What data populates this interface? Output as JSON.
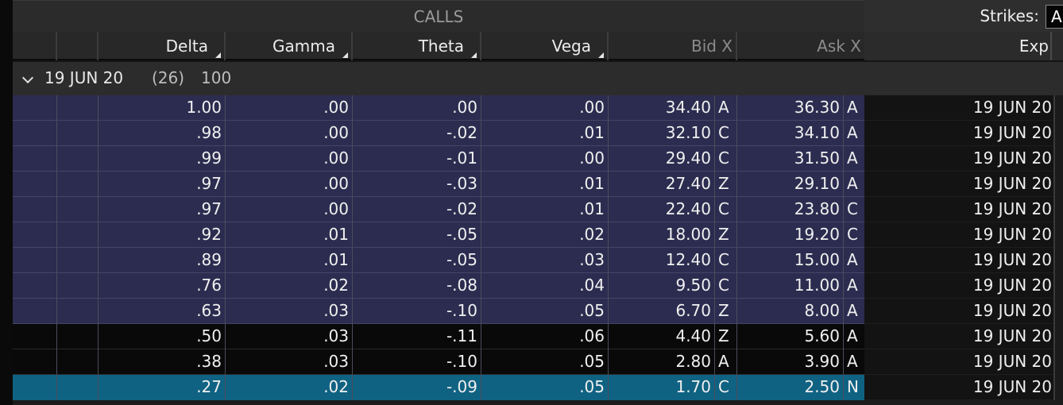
{
  "header": {
    "section_title": "CALLS",
    "strikes_label": "Strikes:",
    "strikes_value": "A",
    "columns": [
      "Delta",
      "Gamma",
      "Theta",
      "Vega",
      "Bid X",
      "Ask X"
    ],
    "exp_label": "Exp"
  },
  "group": {
    "date": "19 JUN 20",
    "count": "(26)",
    "multiplier": "100"
  },
  "rows": [
    {
      "delta": "1.00",
      "gamma": ".00",
      "theta": ".00",
      "vega": ".00",
      "bid": "34.40",
      "bid_ex": "A",
      "ask": "36.30",
      "ask_ex": "A",
      "exp": "19 JUN 20",
      "style": "itm"
    },
    {
      "delta": ".98",
      "gamma": ".00",
      "theta": "-.02",
      "vega": ".01",
      "bid": "32.10",
      "bid_ex": "C",
      "ask": "34.10",
      "ask_ex": "A",
      "exp": "19 JUN 20",
      "style": "itm"
    },
    {
      "delta": ".99",
      "gamma": ".00",
      "theta": "-.01",
      "vega": ".00",
      "bid": "29.40",
      "bid_ex": "C",
      "ask": "31.50",
      "ask_ex": "A",
      "exp": "19 JUN 20",
      "style": "itm"
    },
    {
      "delta": ".97",
      "gamma": ".00",
      "theta": "-.03",
      "vega": ".01",
      "bid": "27.40",
      "bid_ex": "Z",
      "ask": "29.10",
      "ask_ex": "A",
      "exp": "19 JUN 20",
      "style": "itm"
    },
    {
      "delta": ".97",
      "gamma": ".00",
      "theta": "-.02",
      "vega": ".01",
      "bid": "22.40",
      "bid_ex": "C",
      "ask": "23.80",
      "ask_ex": "C",
      "exp": "19 JUN 20",
      "style": "itm"
    },
    {
      "delta": ".92",
      "gamma": ".01",
      "theta": "-.05",
      "vega": ".02",
      "bid": "18.00",
      "bid_ex": "Z",
      "ask": "19.20",
      "ask_ex": "C",
      "exp": "19 JUN 20",
      "style": "itm"
    },
    {
      "delta": ".89",
      "gamma": ".01",
      "theta": "-.05",
      "vega": ".03",
      "bid": "12.40",
      "bid_ex": "C",
      "ask": "15.00",
      "ask_ex": "A",
      "exp": "19 JUN 20",
      "style": "itm"
    },
    {
      "delta": ".76",
      "gamma": ".02",
      "theta": "-.08",
      "vega": ".04",
      "bid": "9.50",
      "bid_ex": "C",
      "ask": "11.00",
      "ask_ex": "A",
      "exp": "19 JUN 20",
      "style": "itm"
    },
    {
      "delta": ".63",
      "gamma": ".03",
      "theta": "-.10",
      "vega": ".05",
      "bid": "6.70",
      "bid_ex": "Z",
      "ask": "8.00",
      "ask_ex": "A",
      "exp": "19 JUN 20",
      "style": "itm"
    },
    {
      "delta": ".50",
      "gamma": ".03",
      "theta": "-.11",
      "vega": ".06",
      "bid": "4.40",
      "bid_ex": "Z",
      "ask": "5.60",
      "ask_ex": "A",
      "exp": "19 JUN 20",
      "style": "otm"
    },
    {
      "delta": ".38",
      "gamma": ".03",
      "theta": "-.10",
      "vega": ".05",
      "bid": "2.80",
      "bid_ex": "A",
      "ask": "3.90",
      "ask_ex": "A",
      "exp": "19 JUN 20",
      "style": "otm"
    },
    {
      "delta": ".27",
      "gamma": ".02",
      "theta": "-.09",
      "vega": ".05",
      "bid": "1.70",
      "bid_ex": "C",
      "ask": "2.50",
      "ask_ex": "N",
      "exp": "19 JUN 20",
      "style": "sel"
    }
  ],
  "colors": {
    "itm_row": "#2c2c50",
    "otm_row": "#090909",
    "selected_row": "#0f6282",
    "header_bg": "#282828"
  }
}
